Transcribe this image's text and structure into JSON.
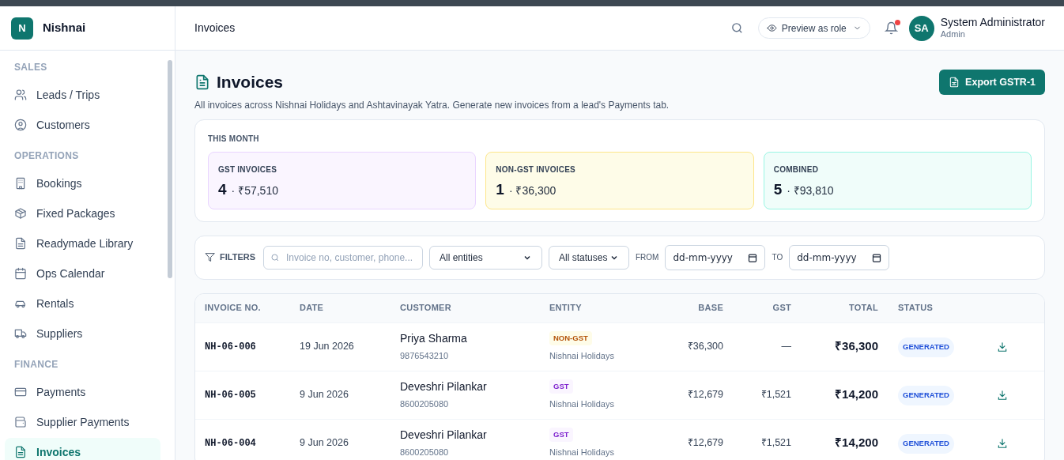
{
  "brand": {
    "initial": "N",
    "name": "Nishnai"
  },
  "sidebar": {
    "sections": [
      {
        "title": "SALES",
        "items": [
          {
            "label": "Leads / Trips",
            "selected": false
          },
          {
            "label": "Customers",
            "selected": false
          }
        ]
      },
      {
        "title": "OPERATIONS",
        "items": [
          {
            "label": "Bookings",
            "selected": false
          },
          {
            "label": "Fixed Packages",
            "selected": false
          },
          {
            "label": "Readymade Library",
            "selected": false
          },
          {
            "label": "Ops Calendar",
            "selected": false
          },
          {
            "label": "Rentals",
            "selected": false
          },
          {
            "label": "Suppliers",
            "selected": false
          }
        ]
      },
      {
        "title": "FINANCE",
        "items": [
          {
            "label": "Payments",
            "selected": false
          },
          {
            "label": "Supplier Payments",
            "selected": false
          },
          {
            "label": "Invoices",
            "selected": true
          }
        ]
      }
    ]
  },
  "header": {
    "breadcrumb": "Invoices",
    "preview_button": "Preview as role",
    "notifications_unread": true,
    "user": {
      "initials": "SA",
      "name": "System Administrator",
      "role": "Admin"
    }
  },
  "page": {
    "title": "Invoices",
    "subtitle": "All invoices across Nishnai Holidays and Ashtavinayak Yatra. Generate new invoices from a lead's Payments tab.",
    "export_button": "Export GSTR-1"
  },
  "summary": {
    "title": "THIS MONTH",
    "cards": [
      {
        "kind": "gst",
        "label": "GST INVOICES",
        "count": "4",
        "amount": "· ₹57,510"
      },
      {
        "kind": "non-gst",
        "label": "NON-GST INVOICES",
        "count": "1",
        "amount": "· ₹36,300"
      },
      {
        "kind": "combined",
        "label": "COMBINED",
        "count": "5",
        "amount": "· ₹93,810"
      }
    ]
  },
  "filters": {
    "label": "FILTERS",
    "search_placeholder": "Invoice no, customer, phone...",
    "entity": "All entities",
    "status": "All statuses",
    "from_label": "FROM",
    "from_placeholder": "dd-mm-yyyy",
    "to_label": "TO",
    "to_placeholder": "dd-mm-yyyy"
  },
  "table": {
    "columns": [
      "INVOICE NO.",
      "DATE",
      "CUSTOMER",
      "ENTITY",
      "BASE",
      "GST",
      "TOTAL",
      "STATUS"
    ],
    "rows": [
      {
        "invoice_no": "NH-06-006",
        "date": "19 Jun 2026",
        "customer": "Priya Sharma",
        "phone": "9876543210",
        "entity_tag": {
          "kind": "non-gst",
          "label": "NON-GST"
        },
        "entity": "Nishnai Holidays",
        "base": "₹36,300",
        "gst": "—",
        "total": "₹36,300",
        "status": "GENERATED"
      },
      {
        "invoice_no": "NH-06-005",
        "date": "9 Jun 2026",
        "customer": "Deveshri Pilankar",
        "phone": "8600205080",
        "entity_tag": {
          "kind": "gst",
          "label": "GST"
        },
        "entity": "Nishnai Holidays",
        "base": "₹12,679",
        "gst": "₹1,521",
        "total": "₹14,200",
        "status": "GENERATED"
      },
      {
        "invoice_no": "NH-06-004",
        "date": "9 Jun 2026",
        "customer": "Deveshri Pilankar",
        "phone": "8600205080",
        "entity_tag": {
          "kind": "gst",
          "label": "GST"
        },
        "entity": "Nishnai Holidays",
        "base": "₹12,679",
        "gst": "₹1,521",
        "total": "₹14,200",
        "status": "GENERATED"
      }
    ]
  }
}
